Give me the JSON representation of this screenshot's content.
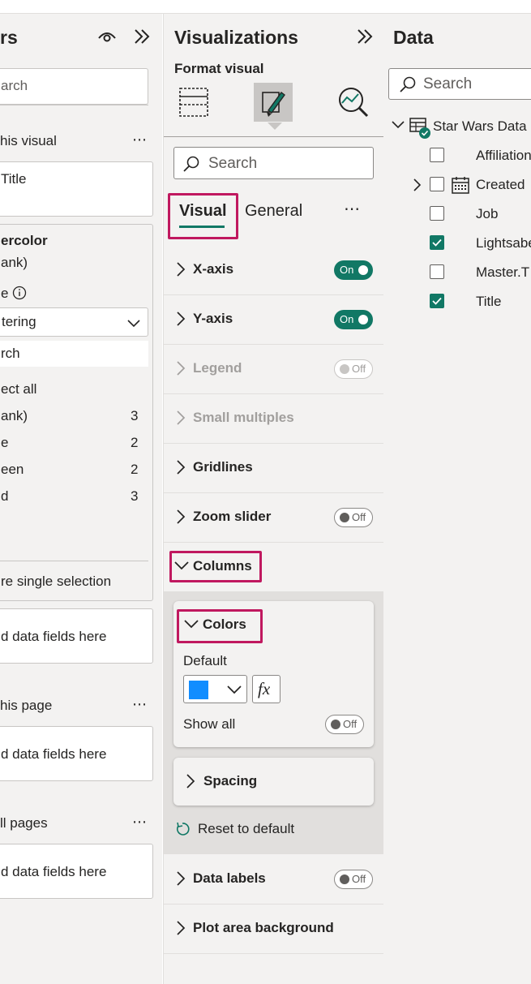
{
  "filters": {
    "title": "rs",
    "search_placeholder": "arch",
    "on_this_visual_label": "his visual",
    "title_card_text": "Title",
    "filter_card": {
      "field_name": "ercolor",
      "field_value": "ank)",
      "filter_type_label": "e",
      "filter_type_value": "tering",
      "search_placeholder": "rch",
      "select_all_label": "ect all",
      "items": [
        {
          "label": "ank)",
          "count": "3"
        },
        {
          "label": "e",
          "count": "2"
        },
        {
          "label": "een",
          "count": "2"
        },
        {
          "label": "d",
          "count": "3"
        }
      ],
      "require_single_label": "re single selection"
    },
    "add_fields_visual": "d data fields here",
    "on_this_page_label": "his page",
    "add_fields_page": "d data fields here",
    "all_pages_label": "ll pages",
    "add_fields_all": "d data fields here",
    "more_icon": "⋯"
  },
  "viz": {
    "title": "Visualizations",
    "format_label": "Format visual",
    "search_placeholder": "Search",
    "tabs": [
      {
        "label": "Visual",
        "active": true
      },
      {
        "label": "General",
        "active": false
      }
    ],
    "more_icon": "⋯",
    "sections": [
      {
        "name": "X-axis",
        "toggle": "On",
        "state": "on",
        "disabled": false
      },
      {
        "name": "Y-axis",
        "toggle": "On",
        "state": "on",
        "disabled": false
      },
      {
        "name": "Legend",
        "toggle": "Off",
        "state": "off",
        "disabled": true
      },
      {
        "name": "Small multiples",
        "toggle": "",
        "state": "none",
        "disabled": true
      },
      {
        "name": "Gridlines",
        "toggle": "",
        "state": "none",
        "disabled": false
      },
      {
        "name": "Zoom slider",
        "toggle": "Off",
        "state": "off",
        "disabled": false
      }
    ],
    "columns_label": "Columns",
    "colors": {
      "label": "Colors",
      "default_label": "Default",
      "swatch_color": "#118dff",
      "fx_label": "fx",
      "show_all_label": "Show all",
      "show_all_toggle": "Off"
    },
    "spacing_label": "Spacing",
    "reset_label": "Reset to default",
    "data_labels": {
      "name": "Data labels",
      "toggle": "Off"
    },
    "plot_area_label": "Plot area background",
    "accent_color": "#117865",
    "highlight_color": "#c0185f"
  },
  "data": {
    "title": "Data",
    "search_placeholder": "Search",
    "table_name": "Star Wars Data",
    "fields": [
      {
        "label": "Affiliation",
        "checked": false,
        "type": "text"
      },
      {
        "label": "Created",
        "checked": false,
        "type": "date"
      },
      {
        "label": "Job",
        "checked": false,
        "type": "text"
      },
      {
        "label": "Lightsaber",
        "checked": true,
        "type": "text"
      },
      {
        "label": "Master.T",
        "checked": false,
        "type": "text"
      },
      {
        "label": "Title",
        "checked": true,
        "type": "text"
      }
    ]
  }
}
